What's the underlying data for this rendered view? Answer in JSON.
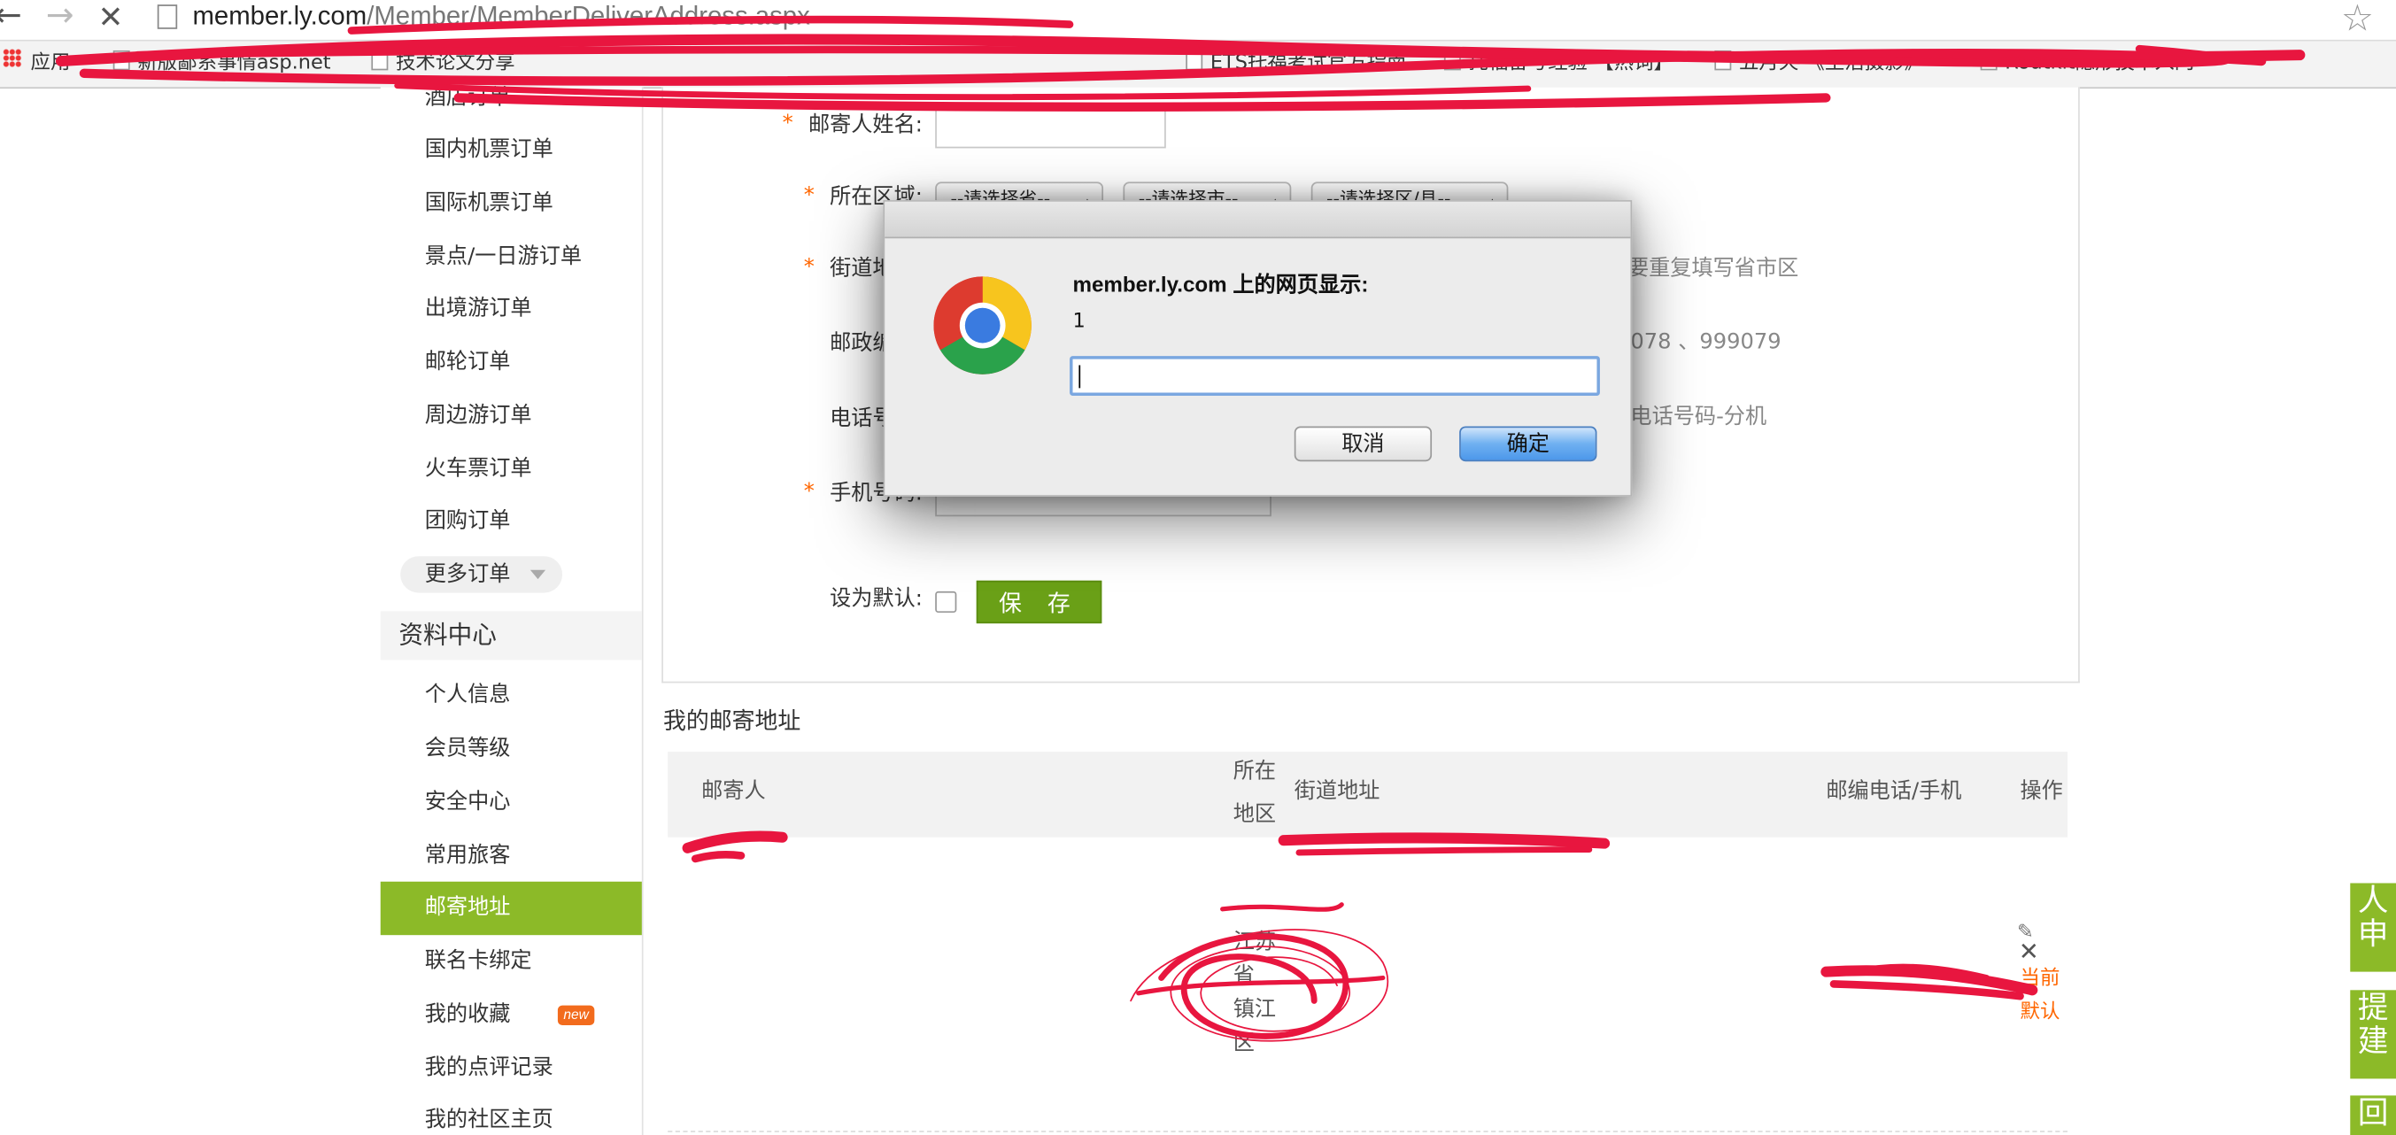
{
  "browser": {
    "url_host": "member.ly.com",
    "url_path": "/Member/MemberDeliverAddress.aspx",
    "bookmarks": [
      "应用",
      "新版鄙系事情asp.net",
      "技术论文分享",
      "ETS托福考试官方指南",
      "托福备考经验 【热词】",
      "五月天 《生活摄影》",
      "Routkit隐形技术入门"
    ]
  },
  "sidebar": {
    "orders": [
      "酒店订单",
      "国内机票订单",
      "国际机票订单",
      "景点/一日游订单",
      "出境游订单",
      "邮轮订单",
      "周边游订单",
      "火车票订单",
      "团购订单"
    ],
    "more_orders": "更多订单",
    "section_title": "资料中心",
    "profile_items": [
      "个人信息",
      "会员等级",
      "安全中心",
      "常用旅客"
    ],
    "active_item": "邮寄地址",
    "profile_items_2": [
      "联名卡绑定",
      "我的收藏",
      "我的点评记录",
      "我的社区主页"
    ],
    "new_badge": "new"
  },
  "form": {
    "star": "*",
    "name_label": "邮寄人姓名:",
    "region_label": "所在区域:",
    "province_select": "--请选择省--",
    "city_select": "--请选择市--",
    "district_select": "--请选择区/县--",
    "street_label": "街道地址:",
    "street_hint": "要重复填写省市区",
    "postcode_label": "邮政编码:",
    "postcode_hint": "078 、999079",
    "phone_label": "电话号码:",
    "phone_hint": "电话号码-分机",
    "mobile_label": "手机号码:",
    "default_label": "设为默认:",
    "save_button": "保 存"
  },
  "address_list": {
    "title": "我的邮寄地址",
    "columns": {
      "recipient": "邮寄人",
      "region": "所在\n地区",
      "street": "街道地址",
      "postcode_phone": "邮编电话/手机",
      "action": "操作"
    },
    "row_region": "江苏\n省\n镇江\n区",
    "row_action": "当前默认"
  },
  "dialog": {
    "title": "member.ly.com 上的网页显示:",
    "message": "1",
    "input_value": "",
    "cancel_button": "取消",
    "ok_button": "确定"
  },
  "floating": {
    "feedback_top": "人申",
    "feedback_mid": "提建",
    "feedback_bottom": "回"
  },
  "colors": {
    "accent_green": "#8cba28",
    "save_green": "#6aa017",
    "required_orange": "#f60",
    "scribble_red": "#e8163f"
  }
}
